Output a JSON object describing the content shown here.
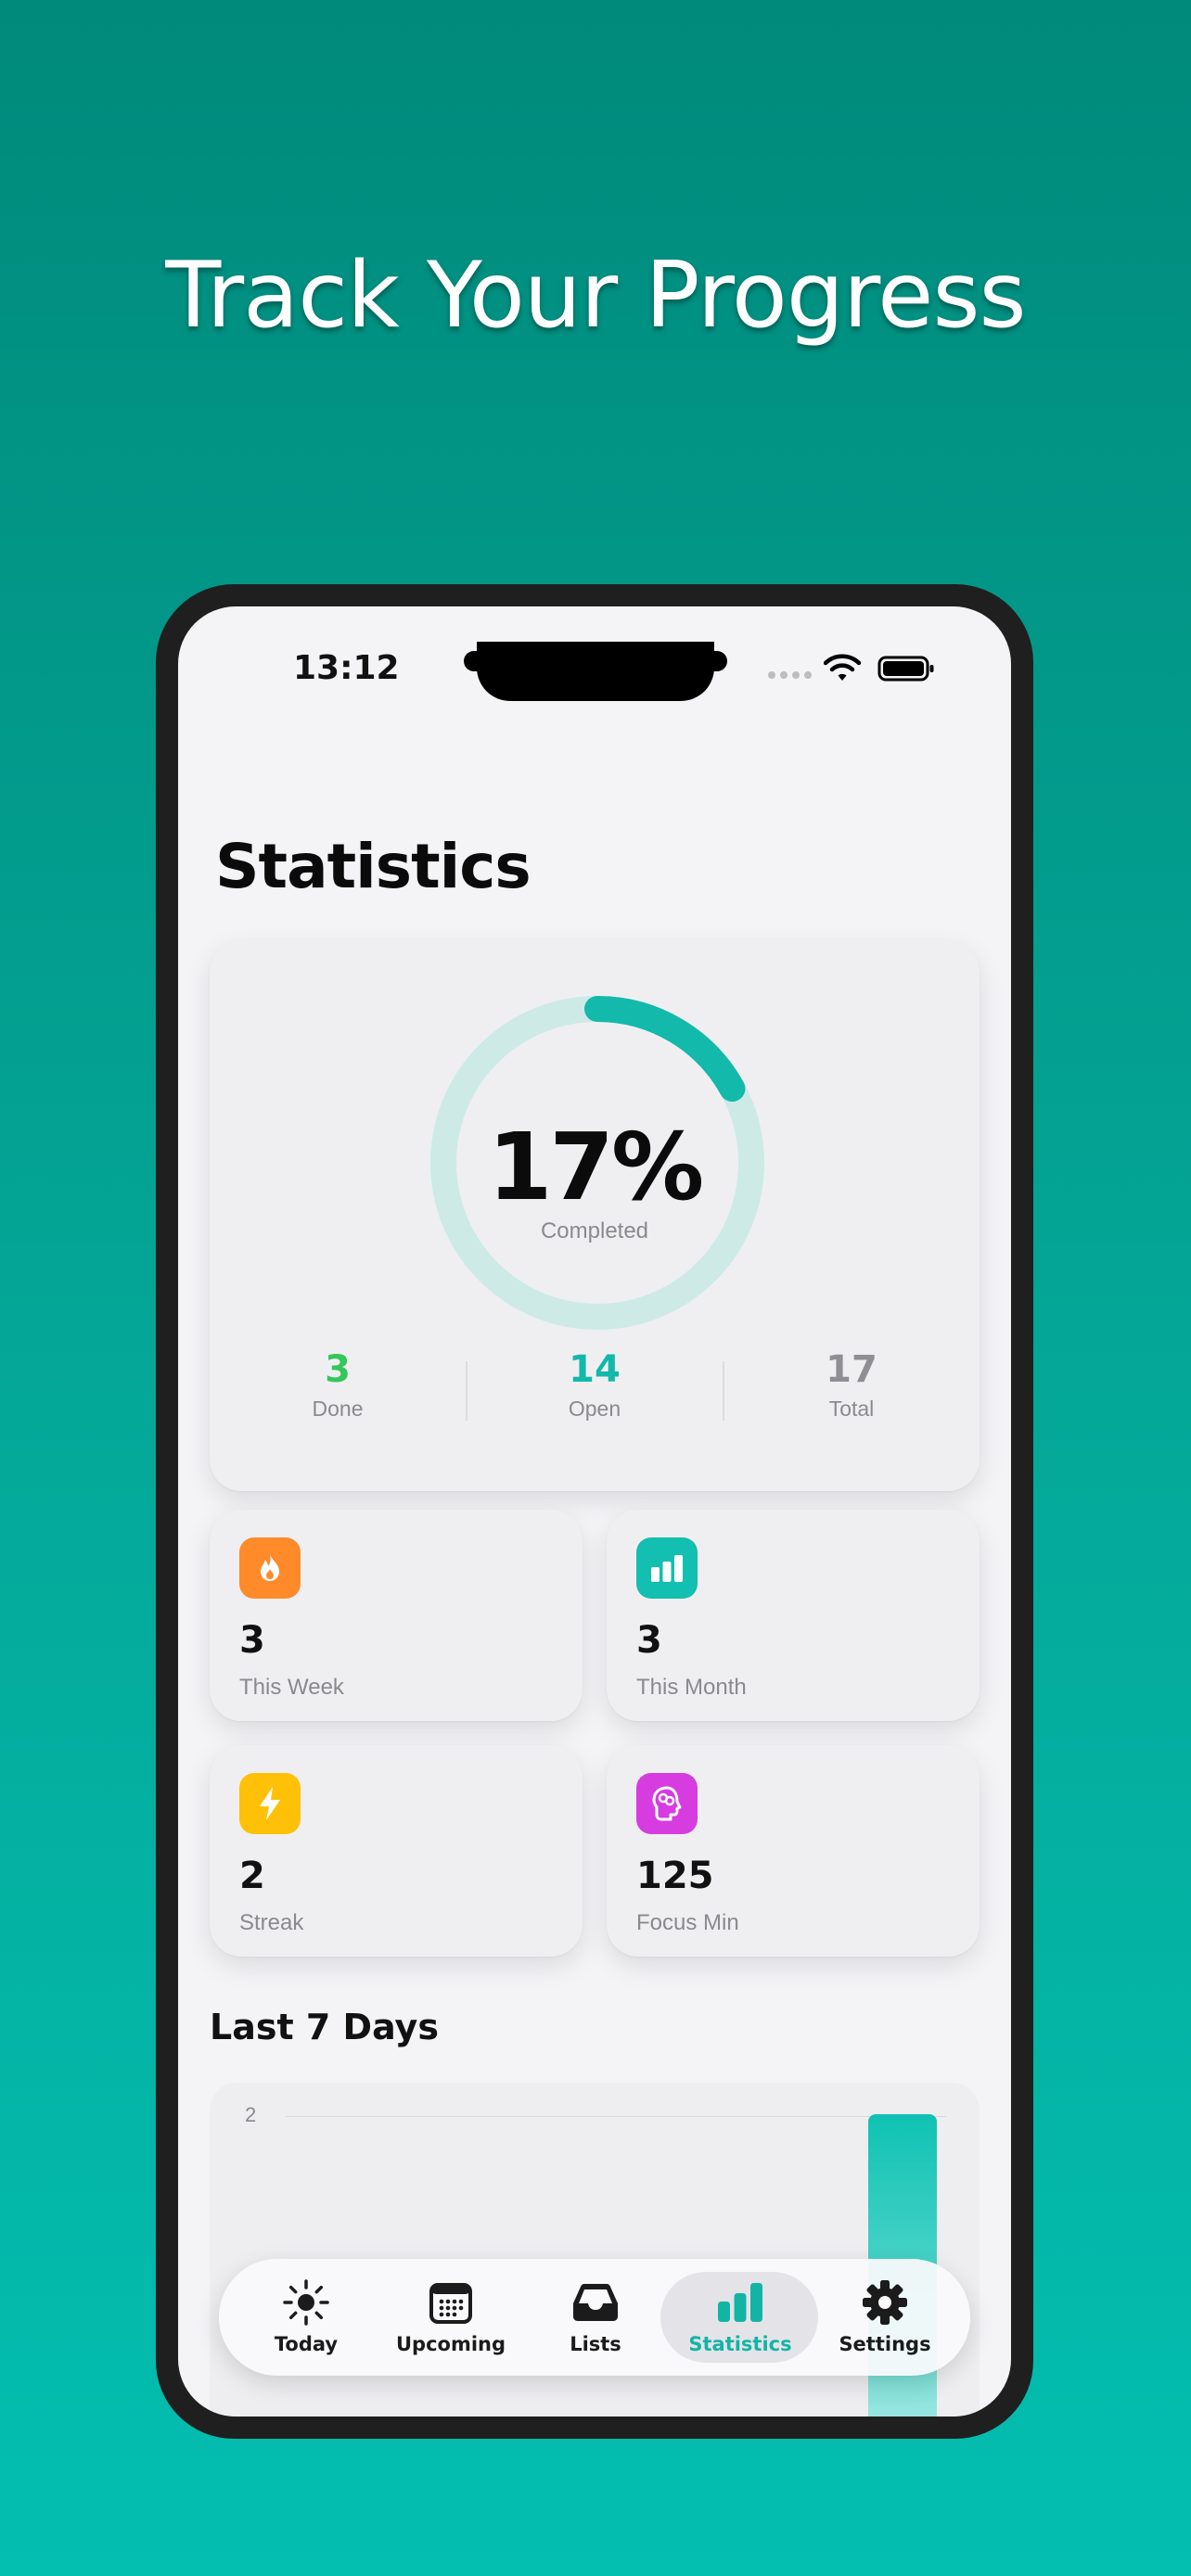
{
  "headline": "Track Your Progress",
  "status_bar": {
    "time": "13:12"
  },
  "page": {
    "title": "Statistics"
  },
  "progress": {
    "percent_label": "17%",
    "percent_value": 17,
    "caption": "Completed",
    "ring_color": "#13b9ab",
    "ring_track_color": "#cdeae7",
    "stats": [
      {
        "value": "3",
        "label": "Done",
        "color": "#34c759"
      },
      {
        "value": "14",
        "label": "Open",
        "color": "#12b8aa"
      },
      {
        "value": "17",
        "label": "Total",
        "color": "#8e8e93"
      }
    ]
  },
  "mini_stats": [
    {
      "value": "3",
      "label": "This Week",
      "icon": "flame-icon",
      "color": "#ff8a2a"
    },
    {
      "value": "3",
      "label": "This Month",
      "icon": "bar-chart-icon",
      "color": "#12bfb0"
    },
    {
      "value": "2",
      "label": "Streak",
      "icon": "bolt-icon",
      "color": "#ffc107"
    },
    {
      "value": "125",
      "label": "Focus Min",
      "icon": "brain-icon",
      "color": "#d63ce0"
    }
  ],
  "chart": {
    "section_title": "Last 7 Days",
    "y_tick": "2"
  },
  "chart_data": {
    "type": "bar",
    "title": "Last 7 Days",
    "ylim": [
      0,
      2
    ],
    "grid": true,
    "values_visible": [
      2
    ],
    "bar_color": "#0fc2b3"
  },
  "tabbar": {
    "tabs": [
      {
        "label": "Today",
        "icon": "sun-icon"
      },
      {
        "label": "Upcoming",
        "icon": "calendar-icon"
      },
      {
        "label": "Lists",
        "icon": "tray-icon"
      },
      {
        "label": "Statistics",
        "icon": "bar-chart-icon",
        "active": true
      },
      {
        "label": "Settings",
        "icon": "gear-icon"
      }
    ],
    "active_color": "#13b4a6"
  }
}
